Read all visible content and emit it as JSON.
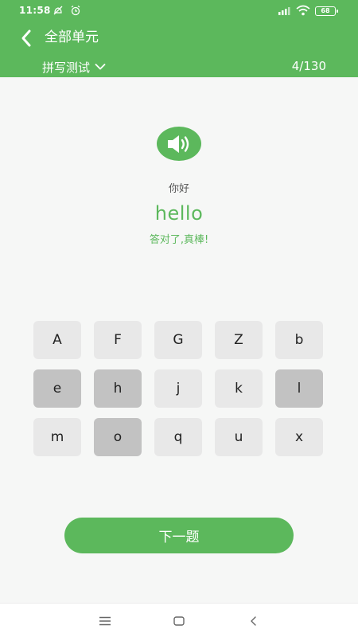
{
  "status_bar": {
    "time": "11:58",
    "battery": "68",
    "icons": [
      "no-disturb-icon",
      "alarm-icon",
      "hd-signal-icon",
      "wifi-icon",
      "battery-icon"
    ]
  },
  "header": {
    "title": "全部单元",
    "back_icon": "chevron-left-icon",
    "mode_label": "拼写测试",
    "mode_icon": "chevron-down-icon",
    "progress": "4/130"
  },
  "question": {
    "speaker_icon": "speaker-icon",
    "meaning": "你好",
    "word": "hello",
    "feedback": "答对了,真棒!"
  },
  "keypad": {
    "keys": [
      {
        "letter": "A",
        "used": false
      },
      {
        "letter": "F",
        "used": false
      },
      {
        "letter": "G",
        "used": false
      },
      {
        "letter": "Z",
        "used": false
      },
      {
        "letter": "b",
        "used": false
      },
      {
        "letter": "e",
        "used": true
      },
      {
        "letter": "h",
        "used": true
      },
      {
        "letter": "j",
        "used": false
      },
      {
        "letter": "k",
        "used": false
      },
      {
        "letter": "l",
        "used": true
      },
      {
        "letter": "m",
        "used": false
      },
      {
        "letter": "o",
        "used": true
      },
      {
        "letter": "q",
        "used": false
      },
      {
        "letter": "u",
        "used": false
      },
      {
        "letter": "x",
        "used": false
      }
    ]
  },
  "actions": {
    "next_label": "下一题"
  },
  "nav_bar": {
    "icons": [
      "menu-icon",
      "home-icon",
      "back-icon"
    ]
  },
  "colors": {
    "primary": "#5cb85c",
    "key_default": "#e8e8e8",
    "key_used": "#c2c2c2",
    "background": "#f6f7f6"
  }
}
